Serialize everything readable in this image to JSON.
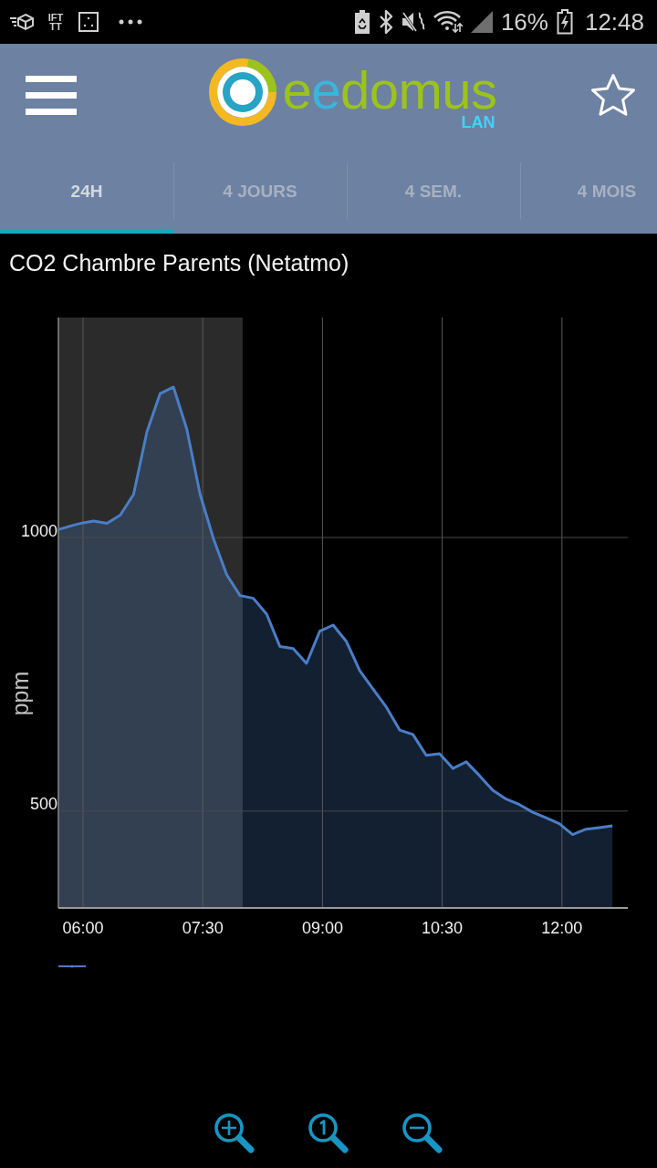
{
  "status_bar": {
    "app_badge": "IFT TT",
    "battery": "16%",
    "time": "12:48"
  },
  "header": {
    "logo": {
      "wordmark": [
        {
          "text": "e",
          "color": "#9cc31b"
        },
        {
          "text": "e",
          "color": "#3ab5dd"
        },
        {
          "text": "domus",
          "color": "#9cc31b"
        }
      ],
      "subtitle": "LAN"
    }
  },
  "tabs": [
    {
      "label": "24H",
      "selected": true
    },
    {
      "label": "4 JOURS",
      "selected": false
    },
    {
      "label": "4 SEM.",
      "selected": false
    },
    {
      "label": "4 MOIS",
      "selected": false
    }
  ],
  "chart": {
    "chart_data": {
      "type": "area",
      "title": "CO2 Chambre Parents (Netatmo)",
      "ylabel": "ppm",
      "x": [
        342,
        352,
        360,
        368,
        378,
        388,
        398,
        408,
        418,
        428,
        438,
        448,
        458,
        468,
        478,
        488,
        498,
        508,
        518,
        528,
        538,
        548,
        558,
        568,
        578,
        588,
        598,
        608,
        618,
        628,
        638,
        648,
        658,
        668,
        678,
        688,
        698,
        708,
        718,
        728,
        738,
        748,
        758
      ],
      "series": [
        {
          "color": "#4a7ec6",
          "values": [
            1015,
            1022,
            1027,
            1030,
            1026,
            1041,
            1079,
            1193,
            1263,
            1275,
            1198,
            1079,
            998,
            932,
            894,
            889,
            860,
            801,
            797,
            770,
            829,
            840,
            810,
            757,
            723,
            690,
            648,
            640,
            602,
            605,
            578,
            590,
            565,
            538,
            522,
            512,
            498,
            488,
            477,
            457,
            467,
            470,
            473
          ]
        }
      ],
      "xlim": [
        341.5,
        769.5
      ],
      "ylim": [
        323,
        1402
      ],
      "xticks": [
        {
          "value": 360,
          "label": "06:00"
        },
        {
          "value": 450,
          "label": "07:30"
        },
        {
          "value": 540,
          "label": "09:00"
        },
        {
          "value": 630,
          "label": "10:30"
        },
        {
          "value": 720,
          "label": "12:00"
        }
      ],
      "yticks": [
        500,
        1000
      ],
      "grid": true,
      "bands": [
        {
          "axis": "x",
          "from": 341.5,
          "to": 480
        }
      ]
    }
  }
}
